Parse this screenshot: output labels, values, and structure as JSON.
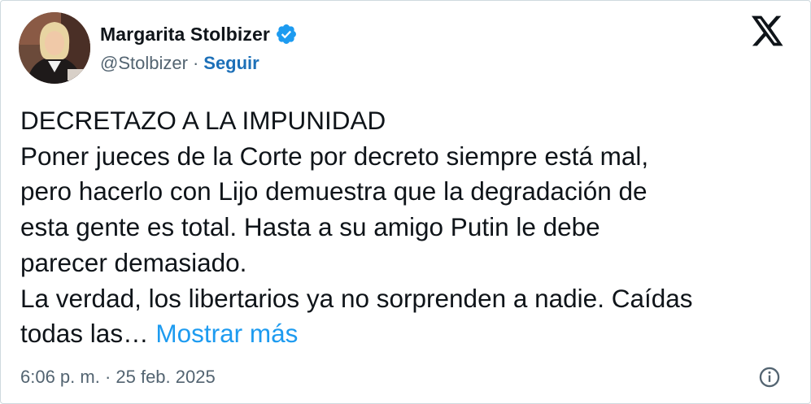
{
  "author": {
    "name": "Margarita Stolbizer",
    "handle": "@Stolbizer",
    "separator": "·",
    "follow_label": "Seguir",
    "verified_icon": "verified-badge-icon",
    "verified_color": "#1d9bf0"
  },
  "header": {
    "logo_icon": "x-logo-icon"
  },
  "tweet": {
    "lines": [
      "DECRETAZO A LA IMPUNIDAD",
      "Poner jueces de la Corte por decreto siempre está mal,",
      "pero hacerlo con Lijo demuestra que la degradación de",
      "esta gente es total. Hasta a su amigo Putin le debe",
      "parecer demasiado.",
      "La verdad, los libertarios ya no sorprenden a nadie. Caídas",
      "todas las…"
    ],
    "show_more_label": "Mostrar más",
    "link_color": "#1d9bf0"
  },
  "footer": {
    "timestamp": "6:06 p. m. · 25 feb. 2025",
    "info_icon": "info-icon"
  }
}
